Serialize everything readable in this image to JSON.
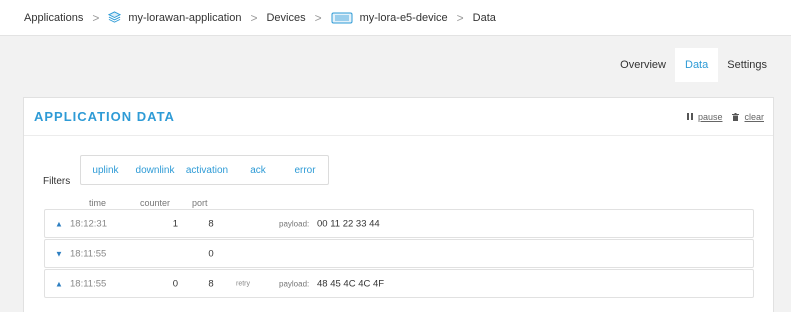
{
  "breadcrumb": {
    "items": [
      "Applications",
      "my-lorawan-application",
      "Devices",
      "my-lora-e5-device",
      "Data"
    ],
    "separator": ">"
  },
  "tabs": [
    {
      "label": "Overview",
      "active": false
    },
    {
      "label": "Data",
      "active": true
    },
    {
      "label": "Settings",
      "active": false
    }
  ],
  "card": {
    "title": "APPLICATION DATA",
    "pause_label": "pause",
    "clear_label": "clear"
  },
  "filters": {
    "label": "Filters",
    "options": [
      "uplink",
      "downlink",
      "activation",
      "ack",
      "error"
    ]
  },
  "columns": {
    "time": "time",
    "counter": "counter",
    "port": "port"
  },
  "rows": [
    {
      "arrow": "▲",
      "time": "18:12:31",
      "counter": "1",
      "port": "8",
      "retry": "",
      "payload_label": "payload:",
      "payload": "00 11 22 33 44"
    },
    {
      "arrow": "▼",
      "time": "18:11:55",
      "counter": "",
      "port": "0",
      "retry": "",
      "payload_label": "",
      "payload": ""
    },
    {
      "arrow": "▲",
      "time": "18:11:55",
      "counter": "0",
      "port": "8",
      "retry": "retry",
      "payload_label": "payload:",
      "payload": "48 45 4C 4C 4F"
    }
  ],
  "colors": {
    "accent": "#2e9bd6",
    "arrow": "#2e7fc1"
  }
}
